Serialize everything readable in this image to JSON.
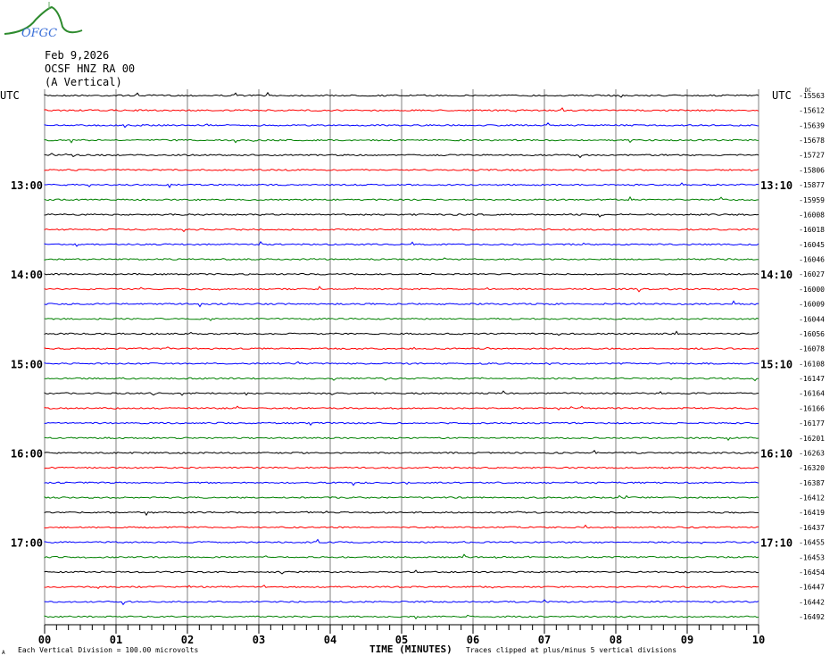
{
  "logo": {
    "text": "OFGC"
  },
  "header": {
    "date": "Feb 9,2026",
    "station": "OCSF HNZ RA 00",
    "component": "(A Vertical)"
  },
  "colors": {
    "trace_cycle": [
      "#000000",
      "#ff0000",
      "#0000ff",
      "#008000"
    ],
    "grid": "#808080"
  },
  "chart_data": {
    "type": "line",
    "title": "Feb 9,2026 OCSF HNZ RA 00 (A Vertical)",
    "xlabel": "TIME (MINUTES)",
    "x_ticks": [
      "00",
      "01",
      "02",
      "03",
      "04",
      "05",
      "06",
      "07",
      "08",
      "09",
      "10"
    ],
    "xlim": [
      0,
      10
    ],
    "left_axis_title": "UTC",
    "right_axis_title": "UTC",
    "right_top_unit": "DC",
    "left_time_labels": [
      {
        "row": 6,
        "label": "13:00"
      },
      {
        "row": 12,
        "label": "14:00"
      },
      {
        "row": 18,
        "label": "15:00"
      },
      {
        "row": 24,
        "label": "16:00"
      },
      {
        "row": 30,
        "label": "17:00"
      }
    ],
    "right_time_labels": [
      {
        "row": 6,
        "label": "13:10"
      },
      {
        "row": 12,
        "label": "14:10"
      },
      {
        "row": 18,
        "label": "15:10"
      },
      {
        "row": 24,
        "label": "16:10"
      },
      {
        "row": 30,
        "label": "17:10"
      }
    ],
    "trace_dc_offsets": [
      -15563,
      -15612,
      -15639,
      -15678,
      -15727,
      -15806,
      -15877,
      -15959,
      -16008,
      -16018,
      -16045,
      -16046,
      -16027,
      -16000,
      -16009,
      -16044,
      -16056,
      -16078,
      -16108,
      -16147,
      -16164,
      -16166,
      -16177,
      -16201,
      -16263,
      -16320,
      -16387,
      -16412,
      -16419,
      -16437,
      -16455,
      -16453,
      -16454,
      -16447,
      -16442,
      -16492
    ],
    "trace_count": 36,
    "minutes_per_trace": 10
  },
  "footer": {
    "scale": "Each Vertical Division =  100.00 microvolts",
    "clip": "Traces clipped at plus/minus 5 vertical divisions",
    "corner": "A"
  }
}
